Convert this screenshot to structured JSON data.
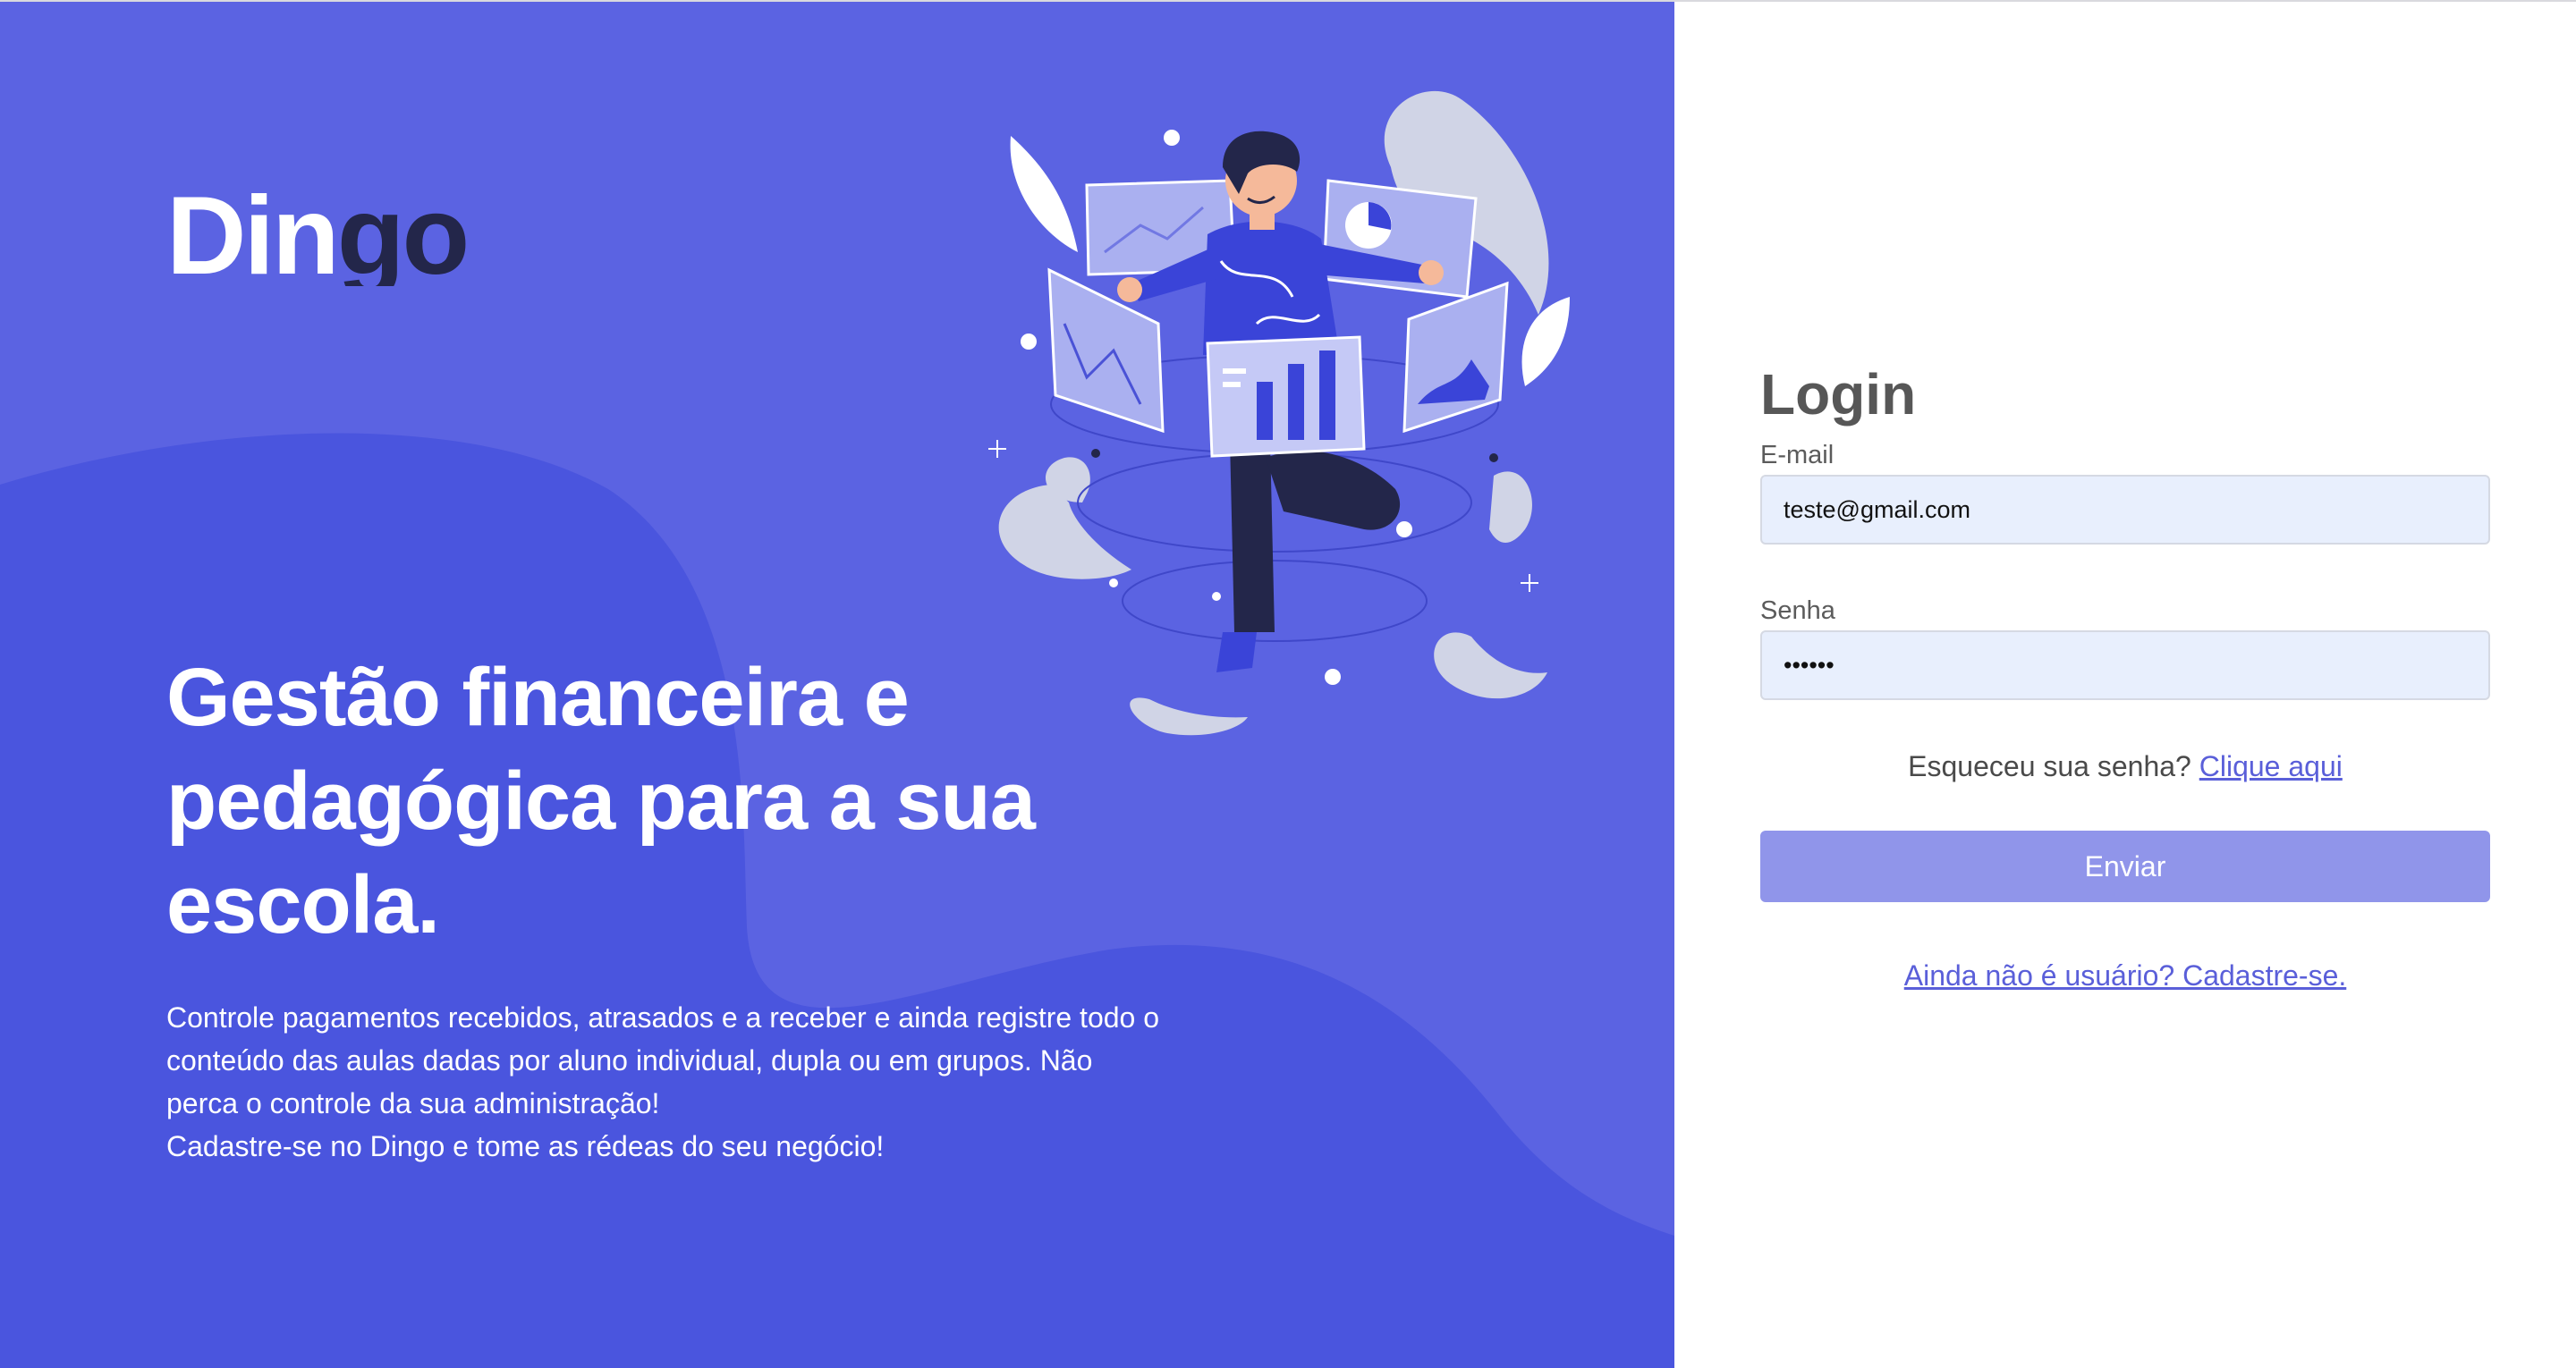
{
  "colors": {
    "hero_background": "#5b63e2",
    "hero_shape": "#4a55de",
    "primary_button": "#9095ea",
    "link": "#5a5fd9",
    "input_background": "#e8effd"
  },
  "hero": {
    "logo": {
      "text_light": "Din",
      "text_dark": "go"
    },
    "illustration_icon": "finance-dashboard-person-illustration",
    "headline": "Gestão financeira e pedagógica para a sua escola.",
    "description_line1": "Controle pagamentos recebidos, atrasados e a receber e ainda registre todo o conteúdo das aulas dadas por aluno individual, dupla ou em grupos. Não perca o controle da sua administração!",
    "description_line2": "Cadastre-se no Dingo e tome as rédeas do seu negócio!"
  },
  "login": {
    "title": "Login",
    "email_label": "E-mail",
    "email_value": "teste@gmail.com",
    "password_label": "Senha",
    "password_value": "••••••",
    "forgot_text": "Esqueceu sua senha? ",
    "forgot_link": "Clique aqui",
    "submit_label": "Enviar",
    "signup_link": "Ainda não é usuário? Cadastre-se."
  }
}
